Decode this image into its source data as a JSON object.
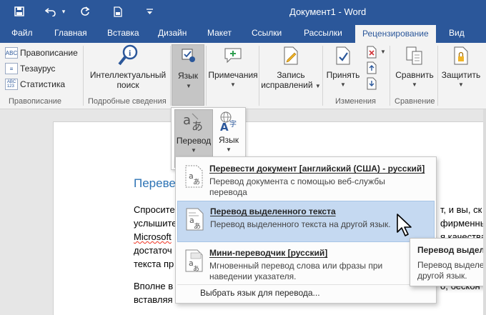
{
  "window": {
    "title": "Документ1 - Word"
  },
  "tabs": [
    "Файл",
    "Главная",
    "Вставка",
    "Дизайн",
    "Макет",
    "Ссылки",
    "Рассылки",
    "Рецензирование",
    "Вид"
  ],
  "ribbon": {
    "spelling": {
      "label": "Правописание",
      "icon_text": "ABC"
    },
    "thesaurus": {
      "label": "Тезаурус"
    },
    "statistics": {
      "label": "Статистика",
      "icon_text": "ABC\n123"
    },
    "group_pravopisanie": "Правописание",
    "smart_lookup": {
      "line1": "Интеллектуальный",
      "line2": "поиск"
    },
    "group_details": "Подробные сведения",
    "language": {
      "label": "Язык"
    },
    "comments": {
      "label": "Примечания"
    },
    "tracking": {
      "line1": "Запись",
      "line2": "исправлений"
    },
    "accept": {
      "label": "Принять"
    },
    "group_changes": "Изменения",
    "compare": {
      "label": "Сравнить"
    },
    "group_compare": "Сравнение",
    "protect": {
      "label": "Защитить"
    }
  },
  "subpopup": {
    "translate": {
      "label": "Перевод"
    },
    "language": {
      "label": "Язык"
    }
  },
  "dropdown": {
    "items": [
      {
        "title": "Перевести документ [английский (США) - русский]",
        "desc": "Перевод документа с помощью веб-службы перевода"
      },
      {
        "title": "Перевод выделенного текста",
        "desc": "Перевод выделенного текста на другой язык."
      },
      {
        "title": "Мини-переводчик [русский]",
        "desc": "Мгновенный перевод слова или фразы при наведении указателя."
      }
    ],
    "choose_language": "Выбрать язык для перевода..."
  },
  "tooltip": {
    "title": "Перевод выдел",
    "text_line1": "Перевод выделен",
    "text_line2": "другой язык."
  },
  "document": {
    "heading": "Переве",
    "line1_left": "Спросите",
    "line1_right": "т, и вы, ск",
    "line2_left": "услышите",
    "line2_right": "фирменны",
    "line3_left": "Microsoft",
    "line3_right": "я качества",
    "line4_left": "достаточ",
    "line5_left": "текста пр",
    "line6_left": "Вполне в",
    "line6_right": "о, бескон",
    "line7_left": "вставляя"
  },
  "colors": {
    "accent": "#2b579a",
    "highlight": "#c5d9f1",
    "heading": "#2e74b5"
  }
}
